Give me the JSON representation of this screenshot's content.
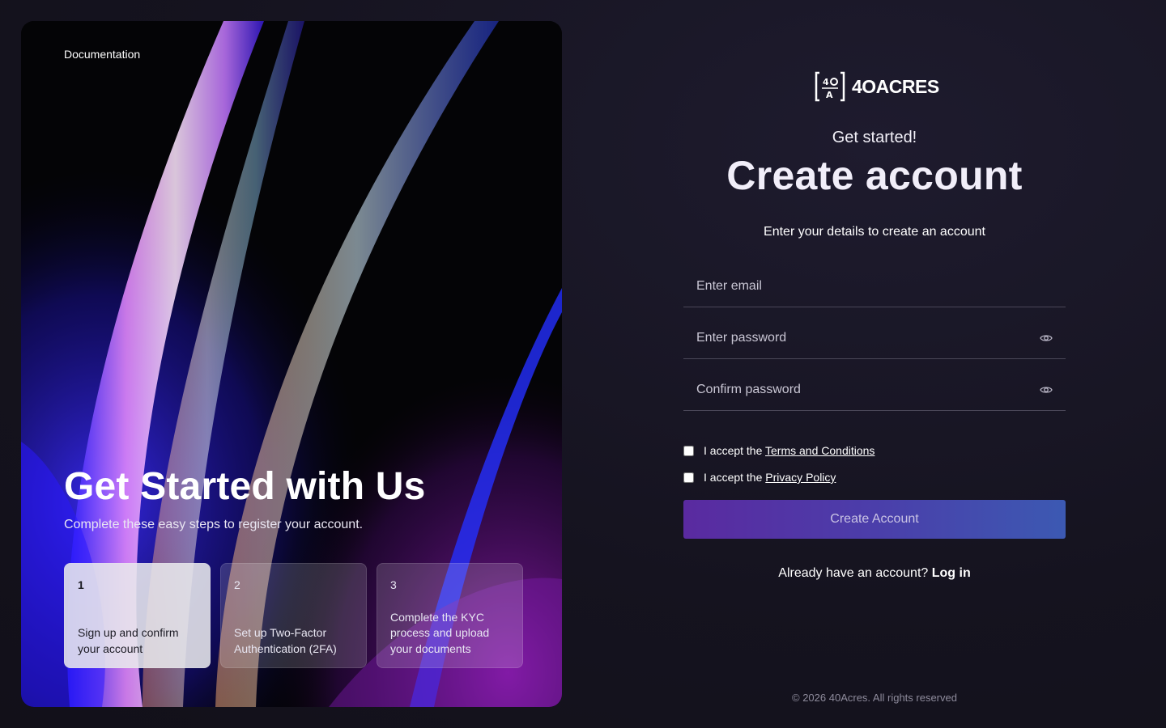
{
  "hero": {
    "documentation_link": "Documentation",
    "title": "Get Started with Us",
    "subtitle": "Complete these easy steps to register your account.",
    "steps": [
      {
        "number": "1",
        "text": "Sign up and confirm your account",
        "active": true
      },
      {
        "number": "2",
        "text": "Set up Two-Factor Authentication (2FA)",
        "active": false
      },
      {
        "number": "3",
        "text": "Complete the KYC process and upload your documents",
        "active": false
      }
    ]
  },
  "form": {
    "logo_text": "4OACRES",
    "kicker": "Get started!",
    "title": "Create account",
    "subtitle": "Enter your details to create an account",
    "email": {
      "value": "",
      "placeholder": "Enter email"
    },
    "password": {
      "value": "",
      "placeholder": "Enter password",
      "icon": "eye-icon"
    },
    "confirm_password": {
      "value": "",
      "placeholder": "Confirm password",
      "icon": "eye-icon"
    },
    "terms": {
      "prefix": "I accept the ",
      "link": "Terms and Conditions",
      "checked": false
    },
    "privacy": {
      "prefix": "I accept the ",
      "link": "Privacy Policy",
      "checked": false
    },
    "submit_label": "Create Account",
    "login_prompt": "Already have an account? ",
    "login_link": "Log in",
    "footer": "© 2026 40Acres. All rights reserved"
  },
  "colors": {
    "background": "#16141f",
    "button_start": "#5a2aa0",
    "button_end": "#3c59b2",
    "input_border": "#4a4758"
  }
}
